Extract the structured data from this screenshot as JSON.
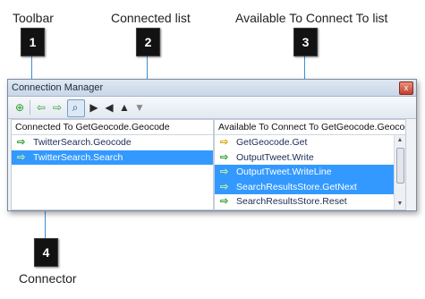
{
  "callouts": {
    "toolbar": {
      "label": "Toolbar",
      "number": "1"
    },
    "connected_list": {
      "label": "Connected list",
      "number": "2"
    },
    "available_list": {
      "label": "Available To Connect To list",
      "number": "3"
    },
    "connector": {
      "label": "Connector",
      "number": "4"
    }
  },
  "window": {
    "title": "Connection Manager",
    "close_glyph": "x"
  },
  "toolbar": {
    "icons": [
      "add-connection-icon",
      "connect-left-icon",
      "connect-right-icon",
      "find-icon",
      "play-icon",
      "back-icon",
      "up-icon",
      "down-icon"
    ]
  },
  "connected": {
    "header": "Connected To GetGeocode.Geocode",
    "items": [
      {
        "label": "TwitterSearch.Geocode",
        "arrow": "green",
        "selected": false
      },
      {
        "label": "TwitterSearch.Search",
        "arrow": "green",
        "selected": true
      }
    ]
  },
  "available": {
    "header": "Available To Connect To GetGeocode.Geocode",
    "items": [
      {
        "label": "GetGeocode.Get",
        "arrow": "yellow",
        "selected": false
      },
      {
        "label": "OutputTweet.Write",
        "arrow": "green",
        "selected": false
      },
      {
        "label": "OutputTweet.WriteLine",
        "arrow": "green",
        "selected": true
      },
      {
        "label": "SearchResultsStore.GetNext",
        "arrow": "green",
        "selected": true
      },
      {
        "label": "SearchResultsStore.Reset",
        "arrow": "green",
        "selected": false
      }
    ]
  },
  "glyphs": {
    "arrow": "⇨",
    "play": "▶",
    "back": "◀",
    "up": "▲",
    "down": "▼",
    "scroll_up": "▲",
    "scroll_down": "▼"
  },
  "colors": {
    "selection": "#3399ff",
    "arrow_green": "#2e9c2e",
    "arrow_yellow": "#d9a400",
    "leader": "#3a8fd9"
  }
}
